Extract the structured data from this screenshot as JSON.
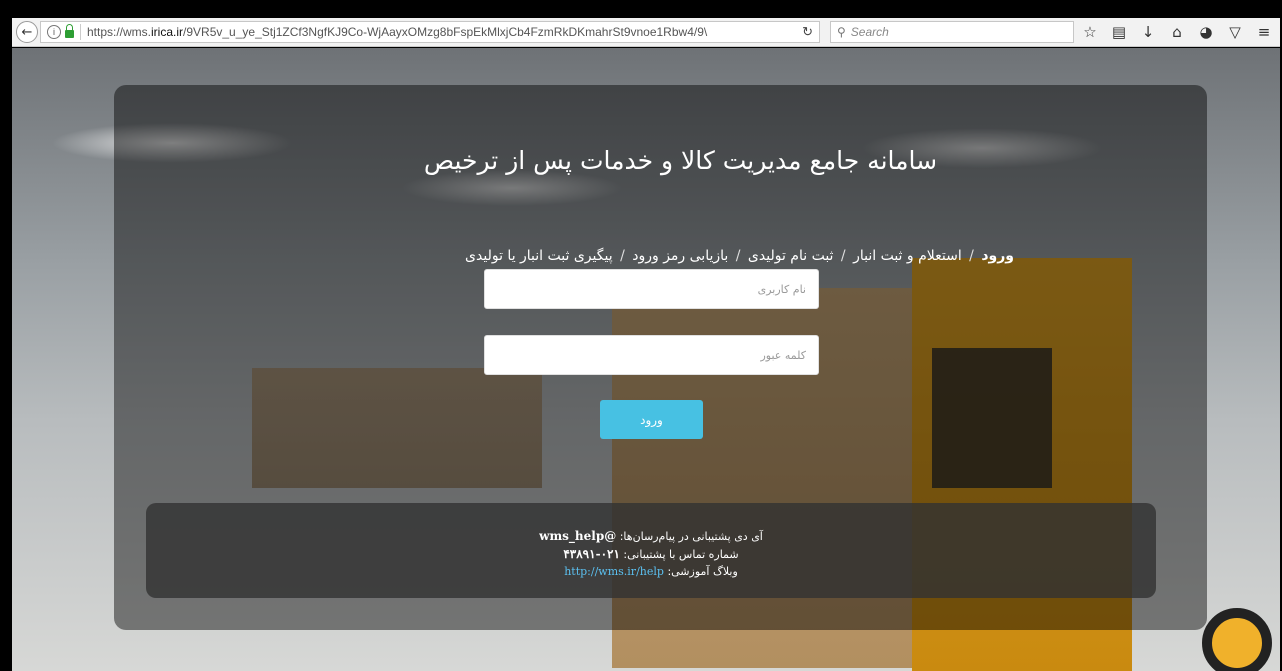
{
  "browser": {
    "url_prefix": "https://wms.",
    "url_domain": "irica.ir",
    "url_path": "/9VR5v_u_ye_Stj1ZCf3NgfKJ9Co-WjAayxOMzg8bFspEkMlxjCb4FzmRkDKmahrSt9vnoe1Rbw4/9\\",
    "search_placeholder": "Search",
    "icons": [
      "back-arrow-icon",
      "info-icon",
      "lock-icon",
      "reload-icon",
      "search-icon",
      "star-icon",
      "reading-list-icon",
      "download-icon",
      "home-icon",
      "chat-icon",
      "pocket-icon",
      "menu-icon"
    ]
  },
  "page": {
    "title": "سامانه جامع مدیریت کالا و خدمات پس از ترخیص",
    "breadcrumb": {
      "login": "ورود",
      "separator": "/",
      "inquiry": "استعلام و ثبت انبار",
      "producer_signup": "ثبت نام تولیدی",
      "recover_password": "بازیابی رمز ورود",
      "track": "پیگیری ثبت انبار یا تولیدی"
    },
    "form": {
      "username_placeholder": "نام کاربری",
      "password_placeholder": "کلمه عبور",
      "submit_label": "ورود"
    },
    "support": {
      "messenger_label": "آی دی پشتیبانی در پیام‌رسان‌ها:",
      "messenger_id": "@wms_help",
      "phone_label": "شماره تماس با پشتیبانی:",
      "phone": "۰۲۱-۴۳۸۹۱",
      "blog_label": "وبلاگ آموزشی:",
      "blog_url": "http://wms.ir/help"
    }
  },
  "colors": {
    "button": "#47c1e3",
    "link": "#5bc0f0",
    "overlay": "rgba(0,0,0,.45)"
  }
}
